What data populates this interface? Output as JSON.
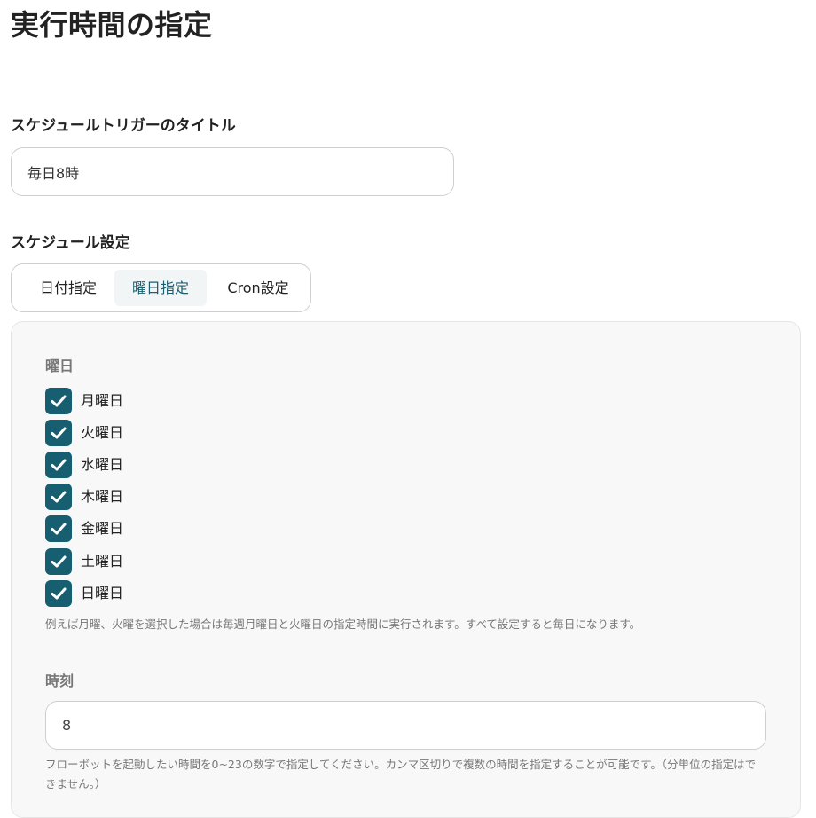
{
  "page": {
    "title": "実行時間の指定"
  },
  "trigger_title": {
    "label": "スケジュールトリガーのタイトル",
    "value": "毎日8時"
  },
  "schedule": {
    "label": "スケジュール設定",
    "tabs": [
      {
        "label": "日付指定",
        "selected": false
      },
      {
        "label": "曜日指定",
        "selected": true
      },
      {
        "label": "Cron設定",
        "selected": false
      }
    ]
  },
  "weekday": {
    "label": "曜日",
    "options": [
      {
        "label": "月曜日",
        "checked": true
      },
      {
        "label": "火曜日",
        "checked": true
      },
      {
        "label": "水曜日",
        "checked": true
      },
      {
        "label": "木曜日",
        "checked": true
      },
      {
        "label": "金曜日",
        "checked": true
      },
      {
        "label": "土曜日",
        "checked": true
      },
      {
        "label": "日曜日",
        "checked": true
      }
    ],
    "help": "例えば月曜、火曜を選択した場合は毎週月曜日と火曜日の指定時間に実行されます。すべて設定すると毎日になります。"
  },
  "time": {
    "label": "時刻",
    "value": "8",
    "help": "フローボットを起動したい時間を0~23の数字で指定してください。カンマ区切りで複数の時間を指定することが可能です。（分単位の指定はできません。）"
  },
  "colors": {
    "checkbox": "#165e70",
    "selected_tab_text": "#1d5d6f",
    "panel_background": "#f8f8f8"
  }
}
